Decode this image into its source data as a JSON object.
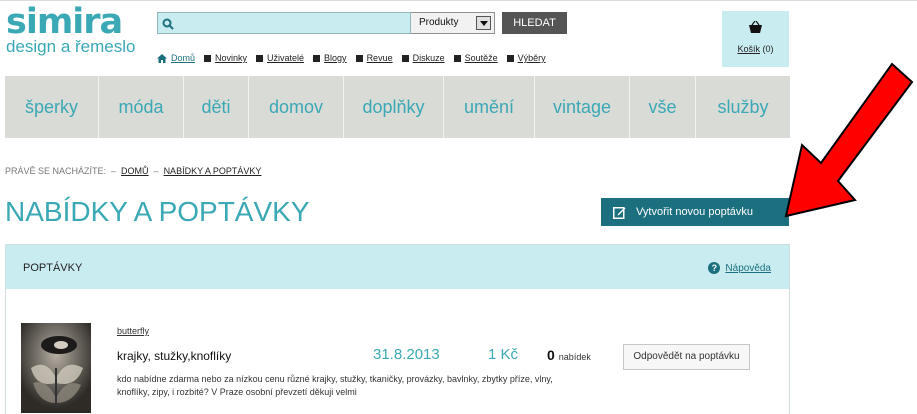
{
  "logo": {
    "name": "simira",
    "tagline": "design a řemeslo"
  },
  "search": {
    "placeholder": "",
    "value": "",
    "category": "Produkty",
    "button": "HLEDAT"
  },
  "subnav": {
    "items": [
      "Domů",
      "Novinky",
      "Uživatelé",
      "Blogy",
      "Revue",
      "Diskuze",
      "Soutěže",
      "Výběry"
    ]
  },
  "cart": {
    "label": "Košík",
    "count": "(0)"
  },
  "categories": [
    "šperky",
    "móda",
    "děti",
    "domov",
    "doplňky",
    "umění",
    "vintage",
    "vše",
    "služby"
  ],
  "breadcrumb": {
    "prefix": "PRÁVĚ SE NACHÁZÍTE:",
    "sep": "–",
    "home": "DOMŮ",
    "current": "NABÍDKY A POPTÁVKY"
  },
  "page": {
    "title": "NABÍDKY A POPTÁVKY",
    "create_button": "Vytvořit novou poptávku"
  },
  "panel": {
    "title": "POPTÁVKY",
    "help": "Nápověda",
    "item": {
      "user": "butterfly",
      "title": "krajky, stužky,knoflíky",
      "date": "31.8.2013",
      "price": "1 Kč",
      "offers_count": "0",
      "offers_label": "nabídek",
      "reply_button": "Odpovědět na poptávku",
      "description": "kdo nabídne zdarma nebo za nízkou cenu různé krajky, stužky, tkaničky, provázky, bavlnky, zbytky příze, vlny, knoflíky, zipy, i rozbité? V Praze osobní převzetí děkuji velmi"
    }
  },
  "colors": {
    "accent": "#3aa8b5",
    "dark_accent": "#1b6f7e",
    "light_bg": "#c9ecf0",
    "nav_bg": "#d9dbd7",
    "arrow": "#ff0000"
  },
  "icons": [
    "search-icon",
    "chevron-down-icon",
    "home-icon",
    "cart-icon",
    "edit-icon",
    "help-icon"
  ]
}
